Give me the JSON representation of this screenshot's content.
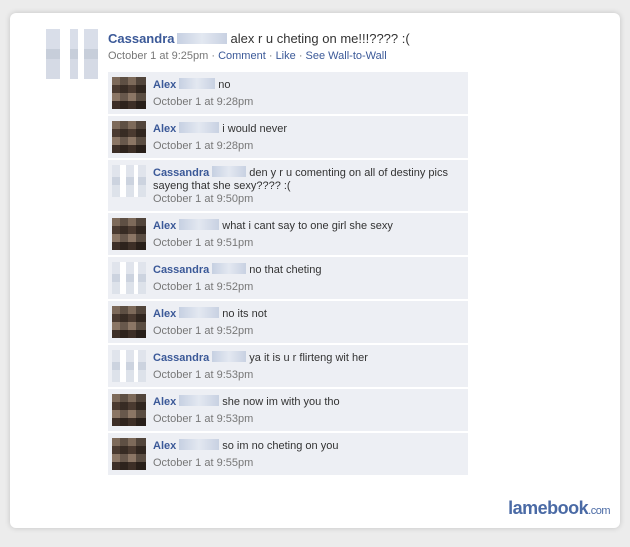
{
  "post": {
    "author": "Cassandra",
    "text": "alex r u cheting on me!!!???? :(",
    "timestamp": "October 1 at 9:25pm",
    "actions": [
      "Comment",
      "Like",
      "See Wall-to-Wall"
    ],
    "separator": "·"
  },
  "comments": [
    {
      "author": "Alex",
      "text": "no",
      "time": "October 1 at 9:28pm",
      "avatar": "alex"
    },
    {
      "author": "Alex",
      "text": "i would never",
      "time": "October 1 at 9:28pm",
      "avatar": "alex"
    },
    {
      "author": "Cassandra",
      "text": "den y r u comenting on all of destiny pics sayeng that she sexy???? :(",
      "time": "October 1 at 9:50pm",
      "avatar": "cassandra"
    },
    {
      "author": "Alex",
      "text": "what i cant say to one girl she sexy",
      "time": "October 1 at 9:51pm",
      "avatar": "alex"
    },
    {
      "author": "Cassandra",
      "text": "no that cheting",
      "time": "October 1 at 9:52pm",
      "avatar": "cassandra"
    },
    {
      "author": "Alex",
      "text": "no its not",
      "time": "October 1 at 9:52pm",
      "avatar": "alex"
    },
    {
      "author": "Cassandra",
      "text": "ya it is u r flirteng wit her",
      "time": "October 1 at 9:53pm",
      "avatar": "cassandra"
    },
    {
      "author": "Alex",
      "text": "she now im with you tho",
      "time": "October 1 at 9:53pm",
      "avatar": "alex"
    },
    {
      "author": "Alex",
      "text": "so im no cheting on you",
      "time": "October 1 at 9:55pm",
      "avatar": "alex"
    }
  ],
  "watermark": {
    "brand": "lamebook",
    "suffix": ".com"
  },
  "colors": {
    "link": "#3b5998",
    "comment_bg": "#edeff4",
    "meta": "#777777"
  }
}
